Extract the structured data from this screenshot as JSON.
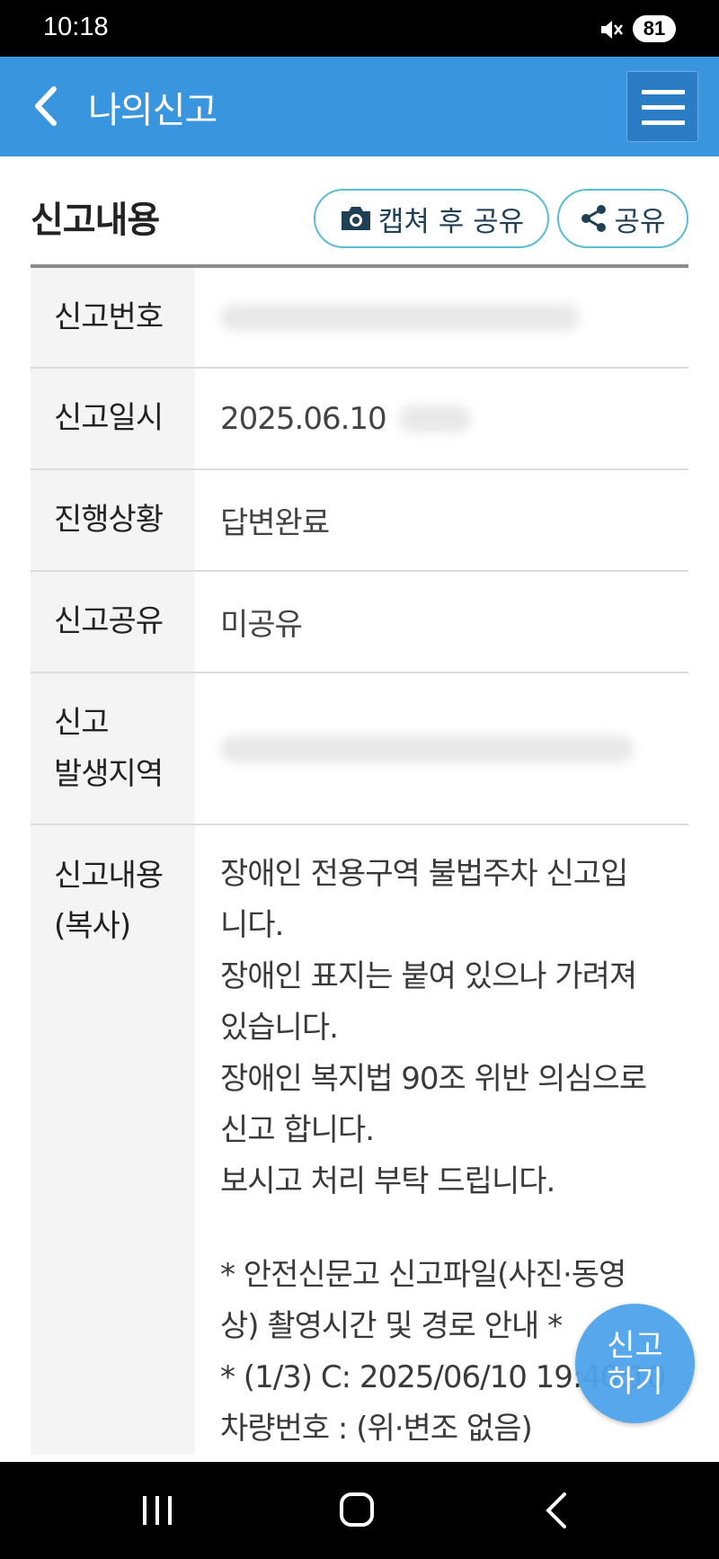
{
  "status_bar": {
    "time": "10:18",
    "battery": "81",
    "icons": [
      "mute-icon"
    ]
  },
  "app_bar": {
    "title": "나의신고",
    "icons": [
      "back-icon",
      "menu-icon"
    ]
  },
  "section": {
    "title": "신고내용",
    "capture_share_label": "캡쳐 후 공유",
    "share_label": "공유",
    "icons": [
      "camera-icon",
      "share-icon"
    ]
  },
  "table": {
    "rows": [
      {
        "label": "신고번호",
        "value": ""
      },
      {
        "label": "신고일시",
        "value": "2025.06.10"
      },
      {
        "label": "진행상황",
        "value": "답변완료"
      },
      {
        "label": "신고공유",
        "value": "미공유"
      },
      {
        "label_line1": "신고",
        "label_line2": "발생지역",
        "value": ""
      },
      {
        "label_line1": "신고내용",
        "label_line2": "(복사)",
        "lines": [
          "장애인 전용구역 불법주차 신고입",
          "니다.",
          "장애인 표지는 붙여 있으나 가려져",
          "있습니다.",
          "장애인 복지법 90조 위반 의심으로",
          "신고 합니다.",
          "보시고 처리 부탁 드립니다.",
          "",
          "* 안전신문고 신고파일(사진·동영",
          "상) 촬영시간 및 경로 안내 *",
          "* (1/3) C: 2025/06/10 19:40:10",
          "차량번호 : (위·변조 없음)"
        ]
      }
    ]
  },
  "fab": {
    "line1": "신고",
    "line2": "하기"
  },
  "nav_bar": {
    "icons": [
      "recent-apps-icon",
      "home-icon",
      "back-nav-icon"
    ]
  }
}
